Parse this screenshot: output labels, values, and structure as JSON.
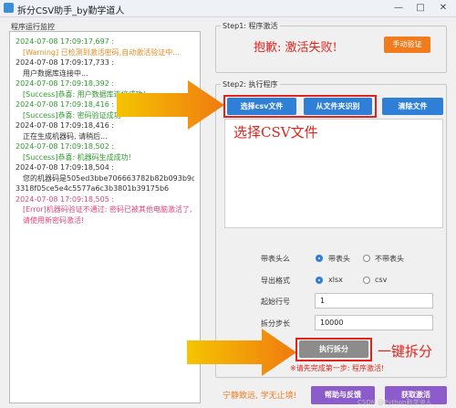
{
  "window": {
    "title": "拆分CSV助手_by勤学道人",
    "minimize": "—",
    "maximize": "□",
    "close": "✕"
  },
  "log": {
    "label": "程序运行监控",
    "lines": [
      {
        "text": "2024-07-08 17:09:17,697 :",
        "color": "green"
      },
      {
        "text": "[Warning] 已检测到激活密码,自动激活验证中...",
        "color": "orange",
        "indent": true
      },
      {
        "text": "2024-07-08 17:09:17,733 :",
        "color": "black"
      },
      {
        "text": "用户数据库连接中...",
        "color": "black",
        "indent": true
      },
      {
        "text": "2024-07-08 17:09:18,392 :",
        "color": "green"
      },
      {
        "text": "[Success]恭喜: 用户数据库连接成功!",
        "color": "green",
        "indent": true
      },
      {
        "text": "2024-07-08 17:09:18,416 :",
        "color": "green"
      },
      {
        "text": "[Success]恭喜: 密码验证成功",
        "color": "green",
        "indent": true
      },
      {
        "text": "2024-07-08 17:09:18,416 :",
        "color": "black"
      },
      {
        "text": "正在生成机器码, 请稍后...",
        "color": "black",
        "indent": true
      },
      {
        "text": "2024-07-08 17:09:18,502 :",
        "color": "green"
      },
      {
        "text": "[Success]恭喜: 机器码生成成功!",
        "color": "green",
        "indent": true
      },
      {
        "text": "2024-07-08 17:09:18,504 :",
        "color": "black"
      },
      {
        "text": "您的机器码是505ed3bbe706663782b82b093b9d4f",
        "color": "black",
        "indent": true
      },
      {
        "text": "3318f05ce5e4c5577a6c3b3801b39175b6",
        "color": "black",
        "indent": false
      },
      {
        "text": "2024-07-08 17:09:18,505 :",
        "color": "red"
      },
      {
        "text": "[Error]机器码验证不通过: 密码已被其他电脑激活了,",
        "color": "red",
        "indent": true
      },
      {
        "text": "请使用新密码激活!",
        "color": "red",
        "indent": true
      }
    ]
  },
  "step1": {
    "title": "Step1: 程序激活",
    "status": "抱歉: 激活失败!",
    "verify_button": "手动验证"
  },
  "step2": {
    "title": "Step2: 执行程序",
    "select_csv_button": "选择csv文件",
    "from_folder_button": "从文件夹识别",
    "clear_button": "清除文件",
    "annotation": "选择CSV文件",
    "header_label": "带表头么",
    "header_yes": "带表头",
    "header_no": "不带表头",
    "format_label": "导出格式",
    "format_xlsx": "xlsx",
    "format_csv": "csv",
    "start_row_label": "起始行号",
    "start_row_value": "1",
    "split_step_label": "拆分步长",
    "split_step_value": "10000",
    "execute_button": "执行拆分",
    "execute_annotation": "一键拆分",
    "tip": "※请先完成第一步: 程序激活!"
  },
  "footer": {
    "slogan": "宁静致远, 学无止境!",
    "help_button": "帮助与反馈",
    "activate_button": "获取激活",
    "watermark": "CSDN @Python勤学道人"
  },
  "colors": {
    "accent_orange": "#f07c1e",
    "accent_blue": "#2f7fd6",
    "accent_purple": "#8c5bcc",
    "error_red": "#e0241c",
    "success_green": "#2e9b2e"
  }
}
